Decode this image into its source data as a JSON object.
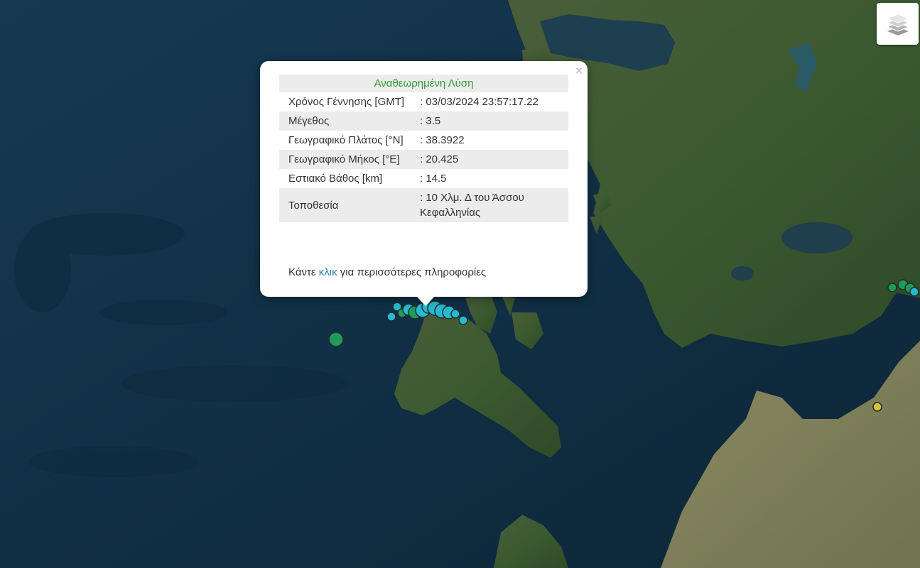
{
  "map": {
    "layers_control_icon": "layers-icon",
    "colors": {
      "sea": "#13324a",
      "land": "#3c5a34",
      "quake_green": "#1f9a59",
      "quake_cyan": "#28b8d0",
      "quake_yellow": "#d9c23a"
    }
  },
  "popup": {
    "close_label": "×",
    "title": "Αναθεωρημένη Λύση",
    "rows": [
      {
        "label": "Χρόνος Γέννησης [GMT]",
        "value": ": 03/03/2024 23:57:17.22"
      },
      {
        "label": "Μέγεθος",
        "value": ": 3.5"
      },
      {
        "label": "Γεωγραφικό Πλάτος [°N]",
        "value": ": 38.3922"
      },
      {
        "label": "Γεωγραφικό Μήκος [°E]",
        "value": ": 20.425"
      },
      {
        "label": "Εστιακό Βάθος [km]",
        "value": ": 14.5"
      },
      {
        "label": "Τοποθεσία",
        "value": ": 10 Χλμ. Δ του Άσσου Κεφαλληνίας"
      }
    ],
    "more_prefix": "Κάντε ",
    "more_link": "κλικ",
    "more_suffix": " για περισσότερες πληροφορίες"
  }
}
